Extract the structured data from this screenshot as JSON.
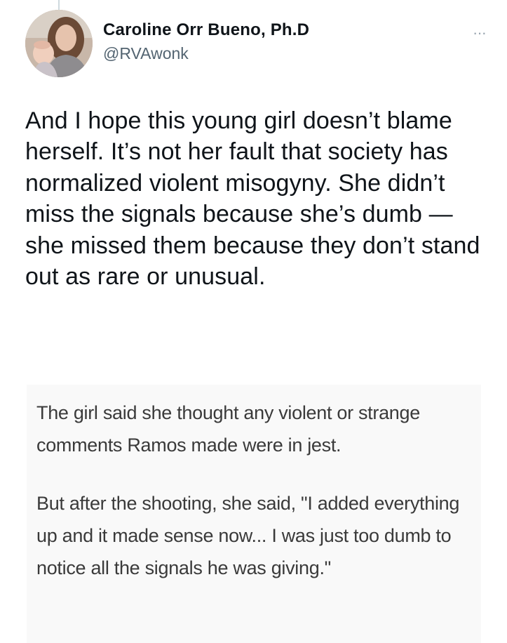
{
  "author": {
    "name": "Caroline Orr Bueno, Ph.D",
    "handle": "@RVAwonk"
  },
  "more_icon": "ellipsis-icon",
  "more_glyph": "···",
  "tweet": {
    "text": "And I hope this young girl doesn’t blame herself. It’s not her fault that society has normalized violent misogyny. She didn’t miss the signals because she’s dumb — she missed them because they don’t stand out as rare or unusual."
  },
  "quote": {
    "paragraphs": [
      "The girl said she thought any violent or strange comments Ramos made were in jest.",
      "But after the shooting, she said, \"I added everything up and it made sense now... I was just too dumb to notice all the signals he was giving.\""
    ]
  },
  "colors": {
    "text": "#0f1419",
    "secondary": "#536471",
    "quote_bg": "#f9f9f9",
    "quote_text": "#3a3a3a"
  }
}
